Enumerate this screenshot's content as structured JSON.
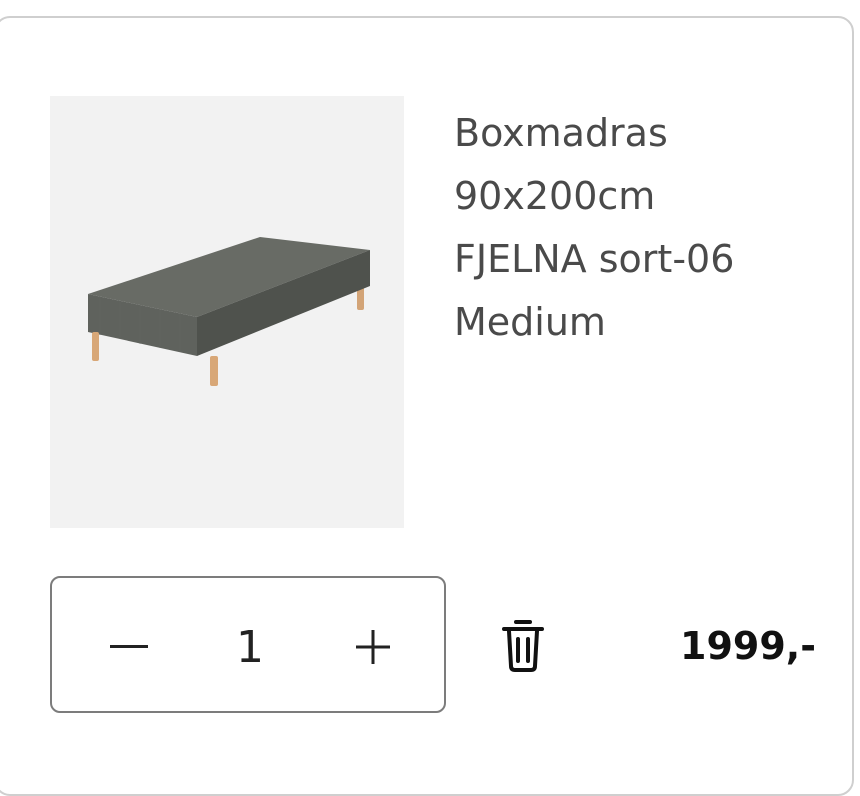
{
  "cart_item": {
    "product_name_lines": [
      "Boxmadras",
      "90x200cm",
      "FJELNA sort-06",
      "Medium"
    ],
    "quantity": "1",
    "price": "1999,-"
  },
  "icons": {
    "decrease": "minus-icon",
    "increase": "plus-icon",
    "remove": "trash-icon"
  },
  "colors": {
    "card_border": "#cfcfcf",
    "image_background": "#f2f2f2",
    "mattress_fabric": "#5d605a",
    "legs": "#d8a777",
    "text_primary": "#4a4a4a",
    "price_text": "#111111"
  }
}
